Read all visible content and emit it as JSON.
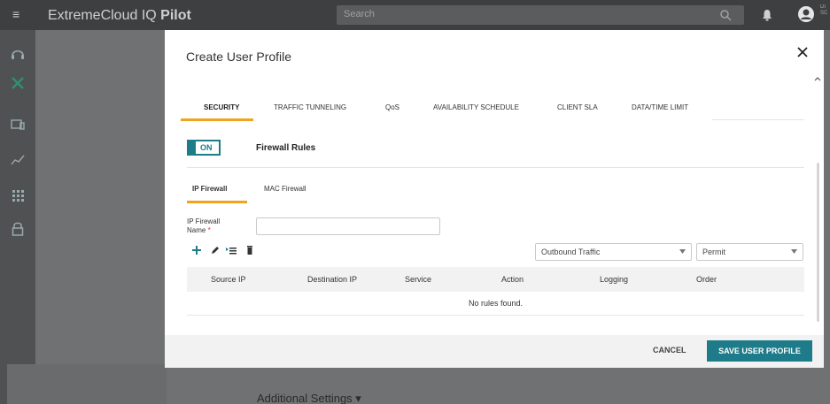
{
  "app": {
    "title_regular": "ExtremeCloud IQ",
    "title_bold": "Pilot",
    "search_placeholder": "Search",
    "user_small_text": "DI SC"
  },
  "background": {
    "additional_settings": "Additional Settings ▾"
  },
  "modal": {
    "title": "Create User Profile",
    "tabs": [
      "SECURITY",
      "TRAFFIC TUNNELING",
      "QoS",
      "AVAILABILITY SCHEDULE",
      "CLIENT SLA",
      "DATA/TIME LIMIT"
    ],
    "active_tab": "SECURITY",
    "toggle_label": "ON",
    "section_title": "Firewall Rules",
    "subtabs": [
      "IP Firewall",
      "MAC Firewall"
    ],
    "active_subtab": "IP Firewall",
    "ip_firewall_name_label": "IP Firewall Name",
    "ip_firewall_name_value": "",
    "traffic_select": "Outbound Traffic",
    "action_select": "Permit",
    "table": {
      "columns": [
        "Source IP",
        "Destination IP",
        "Service",
        "Action",
        "Logging",
        "Order"
      ],
      "empty_message": "No rules found."
    },
    "cancel_label": "CANCEL",
    "save_label": "SAVE USER PROFILE"
  },
  "colors": {
    "accent_teal": "#1e7b8a",
    "tab_underline_orange": "#f0a31c"
  }
}
